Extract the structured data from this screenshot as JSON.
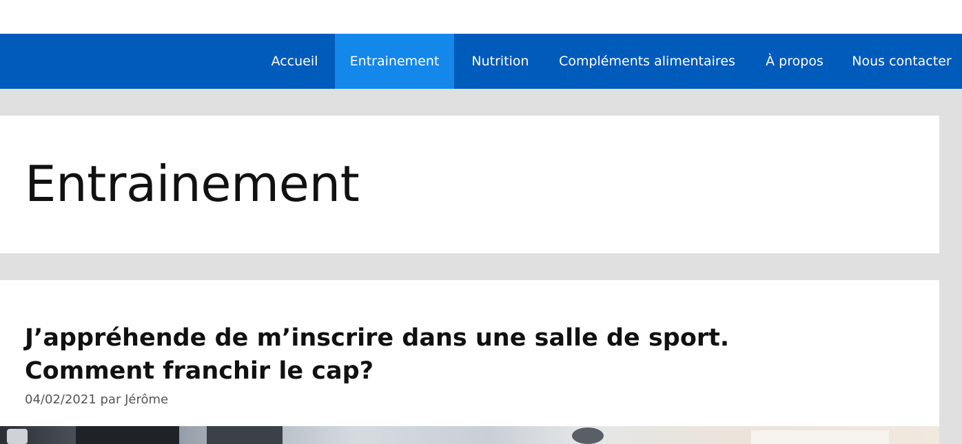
{
  "nav": {
    "items": [
      {
        "label": "Accueil",
        "active": false
      },
      {
        "label": "Entrainement",
        "active": true
      },
      {
        "label": "Nutrition",
        "active": false
      },
      {
        "label": "Compléments alimentaires",
        "active": false
      },
      {
        "label": "À propos",
        "active": false
      },
      {
        "label": "Nous contacter",
        "active": false
      }
    ]
  },
  "page": {
    "title": "Entrainement"
  },
  "post": {
    "title": "J’appréhende de m’inscrire dans une salle de sport. Comment franchir le cap?",
    "date": "04/02/2021",
    "by": "par",
    "author": "Jérôme"
  },
  "colors": {
    "nav_bg": "#005bbb",
    "nav_active_bg": "#1387ea",
    "page_bg": "#e0e0e0",
    "card_bg": "#ffffff"
  }
}
